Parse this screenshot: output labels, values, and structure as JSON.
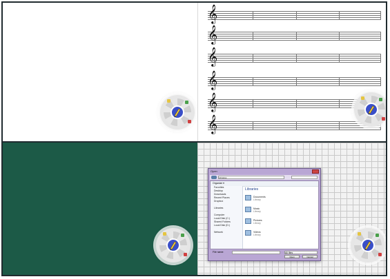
{
  "quadrants": {
    "top_left": {
      "background": "#ffffff"
    },
    "top_right": {
      "background": "#ffffff",
      "staves": 6,
      "staff_clef": "𝄞"
    },
    "bottom_left": {
      "background": "#1c5a47"
    },
    "bottom_right": {
      "background": "#f2f2f2",
      "grid": true
    }
  },
  "palette": {
    "center_color": "#3a4fc8",
    "tool_icon": "pen-icon",
    "accent_dots": [
      "#e5c542",
      "#4aa04a",
      "#d04040",
      "#4060d0"
    ]
  },
  "dialog": {
    "title": "Open",
    "address": "Libraries",
    "toolbar_label": "Organize ▾",
    "heading": "Libraries",
    "sidebar": [
      "Favorites",
      "Desktop",
      "Downloads",
      "Recent Places",
      "Dropbox",
      "",
      "Libraries",
      "",
      "Computer",
      "Local Disk (C:)",
      "Shared Folders",
      "Local Disk (D:)",
      "",
      "Network"
    ],
    "libraries": [
      {
        "name": "Documents",
        "sub": "Library"
      },
      {
        "name": "Music",
        "sub": "Library"
      },
      {
        "name": "Pictures",
        "sub": "Library"
      },
      {
        "name": "Videos",
        "sub": "Library"
      }
    ],
    "file_name_label": "File name:",
    "file_type": "All files",
    "open_button": "Open",
    "cancel_button": "Cancel"
  }
}
